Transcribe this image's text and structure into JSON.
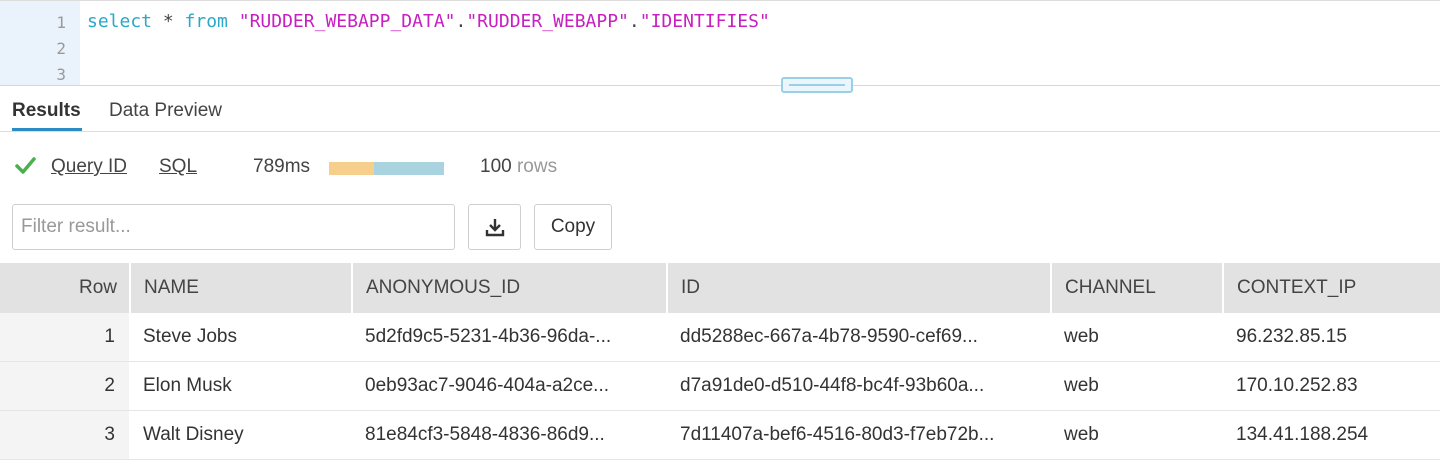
{
  "editor": {
    "line_numbers": [
      "1",
      "2",
      "3"
    ],
    "query": {
      "kw1": "select",
      "star": " * ",
      "kw2": "from",
      "db": "\"RUDDER_WEBAPP_DATA\"",
      "dot1": ".",
      "schema": "\"RUDDER_WEBAPP\"",
      "dot2": ".",
      "table": "\"IDENTIFIES\""
    }
  },
  "tabs": [
    {
      "label": "Results",
      "active": true
    },
    {
      "label": "Data Preview",
      "active": false
    }
  ],
  "stats": {
    "status_icon": "check-icon",
    "query_id_label": "Query ID",
    "sql_label": "SQL",
    "duration": "789ms",
    "duration_split_fraction": 0.39,
    "row_count": "100",
    "rows_word": "rows"
  },
  "filter": {
    "placeholder": "Filter result...",
    "value": ""
  },
  "toolbar": {
    "download_icon": "download-icon",
    "copy_label": "Copy"
  },
  "table": {
    "columns": [
      "Row",
      "NAME",
      "ANONYMOUS_ID",
      "ID",
      "CHANNEL",
      "CONTEXT_IP"
    ],
    "rows": [
      [
        "1",
        "Steve Jobs",
        "5d2fd9c5-5231-4b36-96da-...",
        "dd5288ec-667a-4b78-9590-cef69...",
        "web",
        "96.232.85.15"
      ],
      [
        "2",
        "Elon Musk",
        "0eb93ac7-9046-404a-a2ce...",
        "d7a91de0-d510-44f8-bc4f-93b60a...",
        "web",
        "170.10.252.83"
      ],
      [
        "3",
        "Walt Disney",
        "81e84cf3-5848-4836-86d9...",
        "7d11407a-bef6-4516-80d3-f7eb72b...",
        "web",
        "134.41.188.254"
      ]
    ]
  },
  "colors": {
    "keyword": "#2aa8c9",
    "string": "#c81fc0",
    "success": "#4caf50",
    "accent": "#2b8cc4",
    "bar_compile": "#f7cf8d",
    "bar_execute": "#a9d3de"
  }
}
